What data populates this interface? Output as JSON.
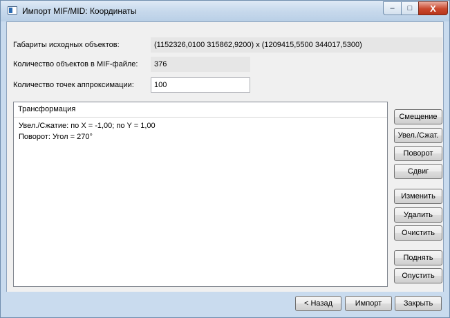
{
  "window": {
    "title": "Импорт MIF/MID: Координаты",
    "min_symbol": "–",
    "max_symbol": "□",
    "close_symbol": "X"
  },
  "form": {
    "bounds_label": "Габариты исходных объектов:",
    "bounds_value": "(1152326,0100  315862,9200) x (1209415,5500  344017,5300)",
    "count_label": "Количество объектов в MIF-файле:",
    "count_value": "376",
    "points_label": "Количество точек аппроксимации:",
    "points_value": "100"
  },
  "transform": {
    "header": "Трансформация",
    "lines": [
      "Увел./Сжатие: по X = -1,00; по Y = 1,00",
      "Поворот: Угол = 270°"
    ]
  },
  "side_buttons": {
    "offset": "Смещение",
    "scale": "Увел./Сжат.",
    "rotate": "Поворот",
    "shift": "Сдвиг",
    "edit": "Изменить",
    "delete": "Удалить",
    "clear": "Очистить",
    "up": "Поднять",
    "down": "Опустить"
  },
  "footer": {
    "back": "< Назад",
    "import": "Импорт",
    "close": "Закрыть"
  }
}
